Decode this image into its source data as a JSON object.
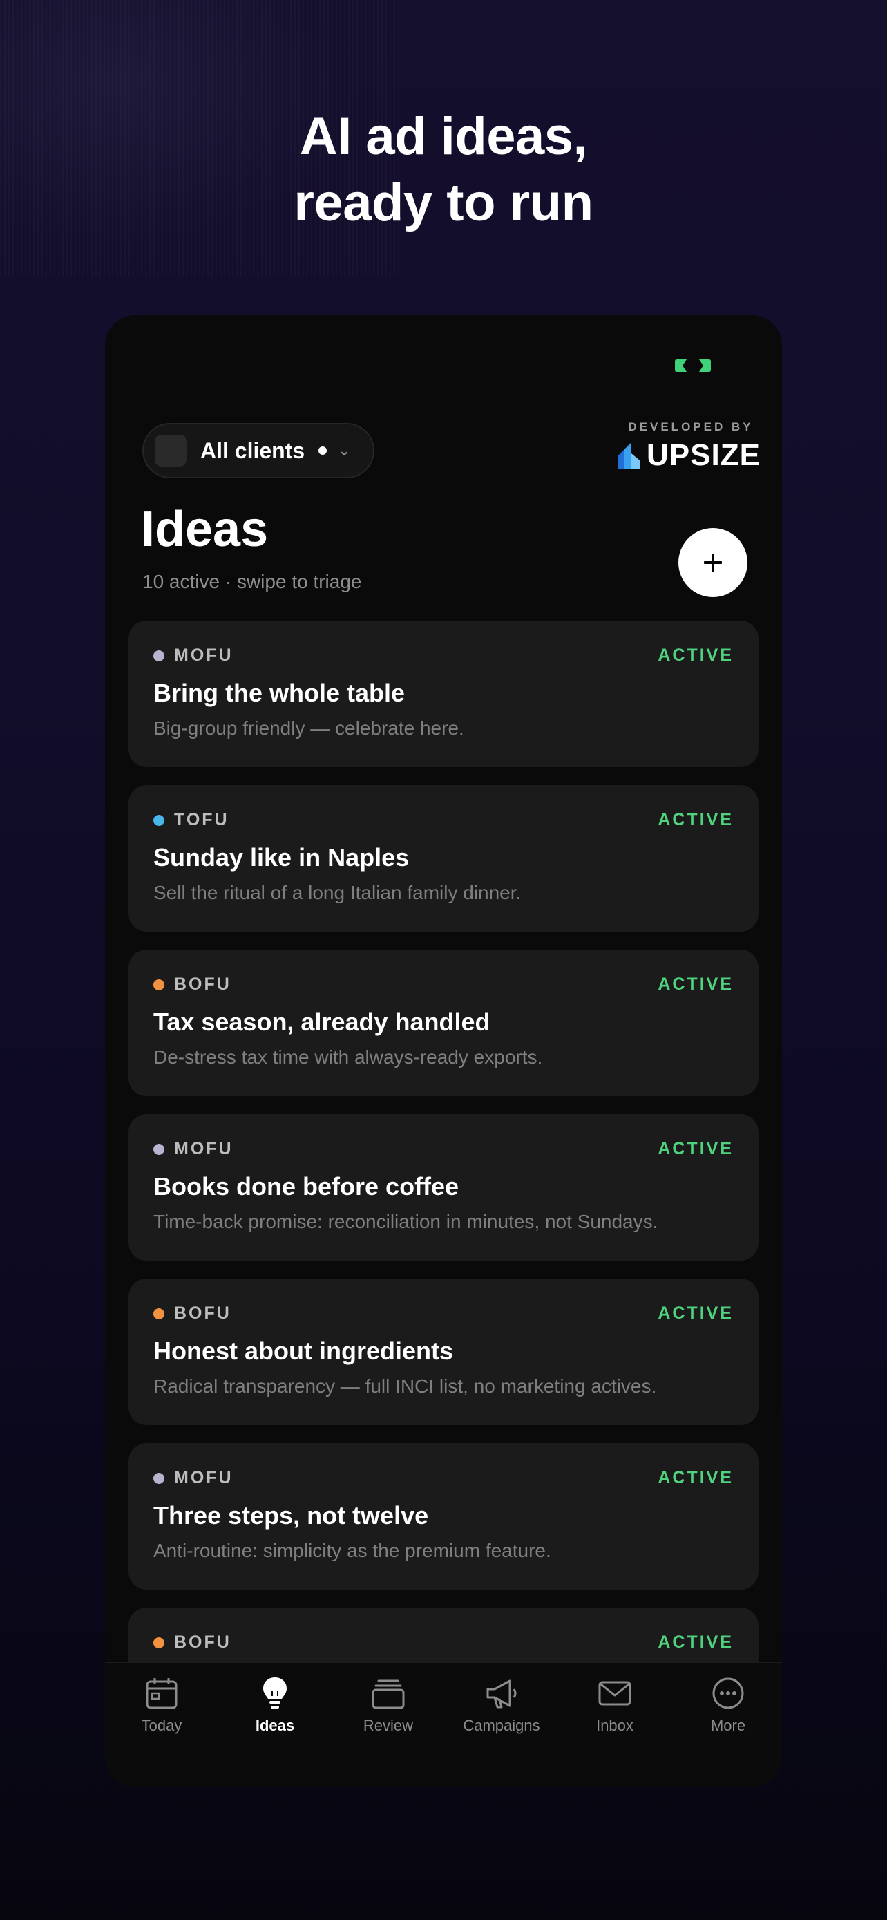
{
  "headline": {
    "line1": "AI ad ideas,",
    "line2": "ready to run"
  },
  "client_selector": {
    "label": "All clients"
  },
  "branding": {
    "developed_by": "DEVELOPED BY",
    "name": "UPSIZE"
  },
  "page": {
    "title": "Ideas",
    "subtitle": "10 active · swipe to triage"
  },
  "colors": {
    "active_green": "#4fd37e",
    "mofu": "#b7b4cf",
    "tofu": "#49b7ea",
    "bofu": "#f0923f"
  },
  "ideas": [
    {
      "stage": "MOFU",
      "status": "ACTIVE",
      "title": "Bring the whole table",
      "description": "Big-group friendly — celebrate here."
    },
    {
      "stage": "TOFU",
      "status": "ACTIVE",
      "title": "Sunday like in Naples",
      "description": "Sell the ritual of a long Italian family dinner."
    },
    {
      "stage": "BOFU",
      "status": "ACTIVE",
      "title": "Tax season, already handled",
      "description": "De-stress tax time with always-ready exports."
    },
    {
      "stage": "MOFU",
      "status": "ACTIVE",
      "title": "Books done before coffee",
      "description": "Time-back promise: reconciliation in minutes, not Sundays."
    },
    {
      "stage": "BOFU",
      "status": "ACTIVE",
      "title": "Honest about ingredients",
      "description": "Radical transparency — full INCI list, no marketing actives."
    },
    {
      "stage": "MOFU",
      "status": "ACTIVE",
      "title": "Three steps, not twelve",
      "description": "Anti-routine: simplicity as the premium feature."
    },
    {
      "stage": "BOFU",
      "status": "ACTIVE",
      "title": "",
      "description": ""
    }
  ],
  "tabs": [
    {
      "label": "Today",
      "icon": "calendar-icon"
    },
    {
      "label": "Ideas",
      "icon": "lightbulb-icon",
      "active": true
    },
    {
      "label": "Review",
      "icon": "stack-icon"
    },
    {
      "label": "Campaigns",
      "icon": "megaphone-icon"
    },
    {
      "label": "Inbox",
      "icon": "mail-icon"
    },
    {
      "label": "More",
      "icon": "more-icon"
    }
  ]
}
